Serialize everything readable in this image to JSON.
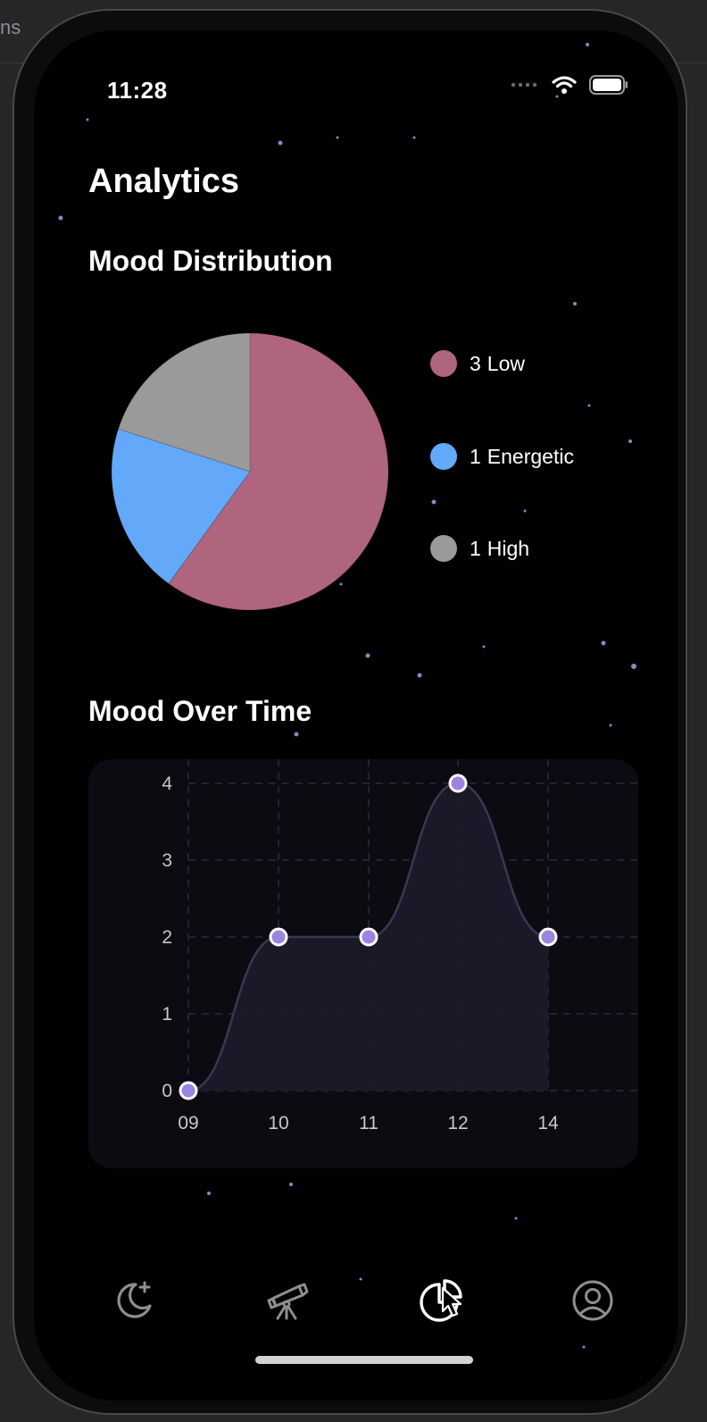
{
  "backdrop": {
    "text": "ns"
  },
  "status_bar": {
    "time": "11:28"
  },
  "page": {
    "title": "Analytics"
  },
  "mood_distribution": {
    "title": "Mood Distribution",
    "legend": [
      {
        "count": "3",
        "label": "Low",
        "color": "#b0657e"
      },
      {
        "count": "1",
        "label": "Energetic",
        "color": "#64a8fa"
      },
      {
        "count": "1",
        "label": "High",
        "color": "#9a9a9a"
      }
    ]
  },
  "mood_over_time": {
    "title": "Mood Over Time"
  },
  "chart_data": [
    {
      "type": "pie",
      "slices": [
        {
          "label": "Low",
          "value": 3,
          "color": "#b0657e"
        },
        {
          "label": "Energetic",
          "value": 1,
          "color": "#64a8fa"
        },
        {
          "label": "High",
          "value": 1,
          "color": "#9a9a9a"
        }
      ]
    },
    {
      "type": "area",
      "x": [
        "09",
        "10",
        "11",
        "12",
        "14"
      ],
      "y": [
        0,
        2,
        2,
        4,
        2
      ],
      "ylim": [
        0,
        4
      ],
      "yticks": [
        "0",
        "1",
        "2",
        "3",
        "4"
      ],
      "grid": true,
      "line_color": "#3a3752",
      "fill_color": "#1c1a2a",
      "point_color": "#9b84e0"
    }
  ],
  "tab_bar": {
    "items": [
      {
        "name": "log-mood",
        "icon": "moon-plus-icon",
        "active": false
      },
      {
        "name": "explore",
        "icon": "telescope-icon",
        "active": false
      },
      {
        "name": "analytics",
        "icon": "pie-chart-icon",
        "active": true
      },
      {
        "name": "profile",
        "icon": "person-circle-icon",
        "active": false
      }
    ]
  }
}
